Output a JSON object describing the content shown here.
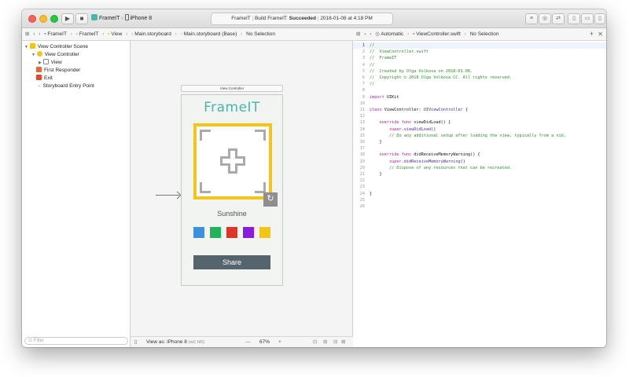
{
  "titlebar": {
    "scheme_target": "FrameIT",
    "scheme_device": "iPhone 8",
    "activity_project": "FrameIT",
    "activity_status_prefix": "Build FrameIT:",
    "activity_status": "Succeeded",
    "activity_time": "2018-01-08 at 4:18 PM"
  },
  "jumpbar_left": {
    "items": [
      "FrameIT",
      "FrameIT",
      "View",
      "Main.storyboard",
      "Main.storyboard (Base)",
      "No Selection"
    ]
  },
  "jumpbar_right": {
    "items": [
      "Automatic",
      "ViewController.swift",
      "No Selection"
    ]
  },
  "navigator": {
    "scene": "View Controller Scene",
    "view_controller": "View Controller",
    "view": "View",
    "first_responder": "First Responder",
    "exit": "Exit",
    "entry_point": "Storyboard Entry Point",
    "filter_placeholder": "Filter"
  },
  "canvas": {
    "vc_label": "View Controller",
    "app_title": "FrameIT",
    "photo_name": "Sunshine",
    "share_label": "Share",
    "swatch_colors": [
      "#3d8fe0",
      "#21b35c",
      "#e03528",
      "#8a1be0",
      "#f5c418"
    ]
  },
  "canvas_bottom": {
    "view_as": "View as: iPhone 8",
    "view_as_traits": "(wC hR)",
    "zoom": "67%"
  },
  "colors": {
    "accent": "#4ab4ad",
    "frame_border": "#f5c418",
    "share_button": "#56656d"
  },
  "code": {
    "lines": [
      [
        {
          "t": "//",
          "c": "comment"
        }
      ],
      [
        {
          "t": "//  ViewController.swift",
          "c": "comment"
        }
      ],
      [
        {
          "t": "//  FrameIT",
          "c": "comment"
        }
      ],
      [
        {
          "t": "//",
          "c": "comment"
        }
      ],
      [
        {
          "t": "//  Created by Olga Volkova on 2018-01-08.",
          "c": "comment"
        }
      ],
      [
        {
          "t": "//  Copyright © 2018 Olga Volkova CC. All rights reserved.",
          "c": "comment"
        }
      ],
      [
        {
          "t": "//",
          "c": "comment"
        }
      ],
      [],
      [
        {
          "t": "import",
          "c": "kw"
        },
        {
          "t": " UIKit",
          "c": "plain"
        }
      ],
      [],
      [
        {
          "t": "class",
          "c": "kw"
        },
        {
          "t": " ViewController: ",
          "c": "plain"
        },
        {
          "t": "UIViewController",
          "c": "type"
        },
        {
          "t": " {",
          "c": "plain"
        }
      ],
      [],
      [
        {
          "t": "    override",
          "c": "kw"
        },
        {
          "t": " ",
          "c": "plain"
        },
        {
          "t": "func",
          "c": "kw"
        },
        {
          "t": " viewDidLoad() {",
          "c": "plain"
        }
      ],
      [
        {
          "t": "        super",
          "c": "kw"
        },
        {
          "t": ".",
          "c": "plain"
        },
        {
          "t": "viewDidLoad",
          "c": "type"
        },
        {
          "t": "()",
          "c": "plain"
        }
      ],
      [
        {
          "t": "        // Do any additional setup after loading the view, typically from a nib.",
          "c": "comment"
        }
      ],
      [
        {
          "t": "    }",
          "c": "plain"
        }
      ],
      [],
      [
        {
          "t": "    override",
          "c": "kw"
        },
        {
          "t": " ",
          "c": "plain"
        },
        {
          "t": "func",
          "c": "kw"
        },
        {
          "t": " didReceiveMemoryWarning() {",
          "c": "plain"
        }
      ],
      [
        {
          "t": "        super",
          "c": "kw"
        },
        {
          "t": ".",
          "c": "plain"
        },
        {
          "t": "didReceiveMemoryWarning",
          "c": "type"
        },
        {
          "t": "()",
          "c": "plain"
        }
      ],
      [
        {
          "t": "        // Dispose of any resources that can be recreated.",
          "c": "comment"
        }
      ],
      [
        {
          "t": "    }",
          "c": "plain"
        }
      ],
      [],
      [],
      [
        {
          "t": "}",
          "c": "plain"
        }
      ],
      [],
      []
    ]
  }
}
